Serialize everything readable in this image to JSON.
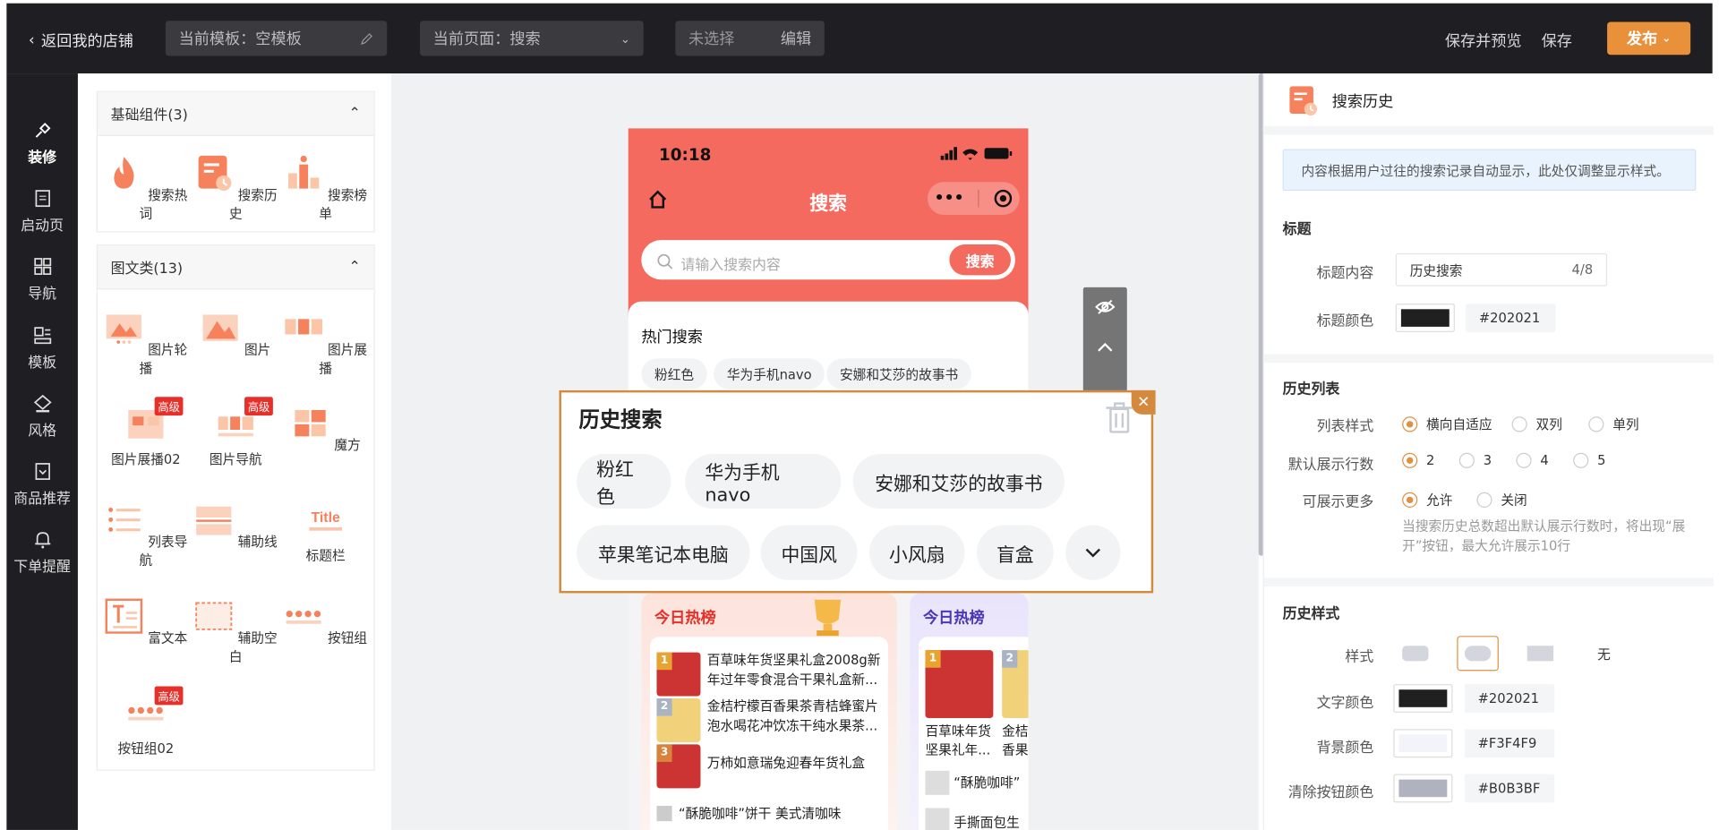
{
  "topbar": {
    "back_label": "返回我的店铺",
    "template_label": "当前模板：空模板",
    "page_label": "当前页面：搜索",
    "selection_label": "未选择",
    "edit_label": "编辑",
    "save_preview_label": "保存并预览",
    "save_label": "保存",
    "publish_label": "发布"
  },
  "sidenav": {
    "items": [
      {
        "label": "装修",
        "icon": "brush-icon",
        "active": true
      },
      {
        "label": "启动页",
        "icon": "document-icon"
      },
      {
        "label": "导航",
        "icon": "grid-icon"
      },
      {
        "label": "模板",
        "icon": "template-icon"
      },
      {
        "label": "风格",
        "icon": "paint-bucket-icon"
      },
      {
        "label": "商品推荐",
        "icon": "recommend-icon"
      },
      {
        "label": "下单提醒",
        "icon": "bell-icon"
      }
    ]
  },
  "components": {
    "basic": {
      "title": "基础组件(3)",
      "items": [
        {
          "label": "搜索热词",
          "icon": "flame-icon"
        },
        {
          "label": "搜索历史",
          "icon": "history-doc-icon"
        },
        {
          "label": "搜索榜单",
          "icon": "ranking-icon"
        }
      ]
    },
    "media": {
      "title": "图文类(13)",
      "badge": "高级",
      "items": [
        {
          "label": "图片轮播",
          "icon": "image-carousel-icon"
        },
        {
          "label": "图片",
          "icon": "image-icon"
        },
        {
          "label": "图片展播",
          "icon": "image-showcase-icon"
        },
        {
          "label": "图片展播02",
          "icon": "image-showcase2-icon"
        },
        {
          "label": "图片导航",
          "icon": "image-nav-icon"
        },
        {
          "label": "魔方",
          "icon": "cube-icon"
        },
        {
          "label": "列表导航",
          "icon": "list-nav-icon"
        },
        {
          "label": "辅助线",
          "icon": "divider-icon"
        },
        {
          "label": "标题栏",
          "icon": "title-bar-icon",
          "glyph": "Title"
        },
        {
          "label": "富文本",
          "icon": "rich-text-icon"
        },
        {
          "label": "辅助空白",
          "icon": "blank-space-icon"
        },
        {
          "label": "按钮组",
          "icon": "button-group-icon"
        },
        {
          "label": "按钮组02",
          "icon": "button-group2-icon"
        }
      ]
    }
  },
  "phone": {
    "time": "10:18",
    "title": "搜索",
    "search_placeholder": "请输入搜索内容",
    "search_button": "搜索",
    "hot_title": "热门搜索",
    "hot_chips": [
      "粉红色",
      "华为手机navo",
      "安娜和艾莎的故事书"
    ],
    "history": {
      "title": "历史搜索",
      "row1": [
        "粉红色",
        "华为手机navo",
        "安娜和艾莎的故事书"
      ],
      "row2": [
        "苹果笔记本电脑",
        "中国风",
        "小风扇",
        "盲盒"
      ]
    },
    "rank_today": {
      "title": "今日热榜",
      "items": [
        {
          "num": "1",
          "text": "百草味年货坚果礼盒2008g新年过年零食混合干果礼盒新..."
        },
        {
          "num": "2",
          "text": "金桔柠檬百香果茶青桔蜂蜜片泡水喝花冲饮冻干纯水果茶..."
        },
        {
          "num": "3",
          "text": "万柿如意瑞兔迎春年货礼盒"
        },
        {
          "num": "",
          "text": "“酥脆咖啡”饼干 美式清咖味"
        }
      ]
    },
    "rank_today2": {
      "title": "今日热榜",
      "items": [
        {
          "num": "1",
          "text": "百草味年货坚果礼年..."
        },
        {
          "num": "2",
          "text": "金桔香果"
        },
        {
          "text": "“酥脆咖啡”"
        },
        {
          "text": "手撕面包生"
        }
      ]
    }
  },
  "props": {
    "header_title": "搜索历史",
    "notice": "内容根据用户过往的搜索记录自动显示，此处仅调整显示样式。",
    "title_section": "标题",
    "title_content_label": "标题内容",
    "title_content_value": "历史搜索",
    "title_count": "4/8",
    "title_color_label": "标题颜色",
    "title_color_hex": "#202021",
    "list_section": "历史列表",
    "list_style_label": "列表样式",
    "list_style_options": [
      "横向自适应",
      "双列",
      "单列"
    ],
    "rows_label": "默认展示行数",
    "rows_options": [
      "2",
      "3",
      "4",
      "5"
    ],
    "more_label": "可展示更多",
    "more_options": [
      "允许",
      "关闭"
    ],
    "more_hint": "当搜索历史总数超出默认展示行数时，将出现“展开”按钮，最大允许展示10行",
    "style_section": "历史样式",
    "style_label": "样式",
    "style_none": "无",
    "text_color_label": "文字颜色",
    "text_color_hex": "#202021",
    "bg_color_label": "背景颜色",
    "bg_color_hex": "#F3F4F9",
    "clear_color_label": "清除按钮颜色",
    "clear_color_hex": "#B0B3BF"
  },
  "colors": {
    "accent": "#e8903a",
    "phone_header": "#f56a5e",
    "selection_border": "#d4893c"
  }
}
